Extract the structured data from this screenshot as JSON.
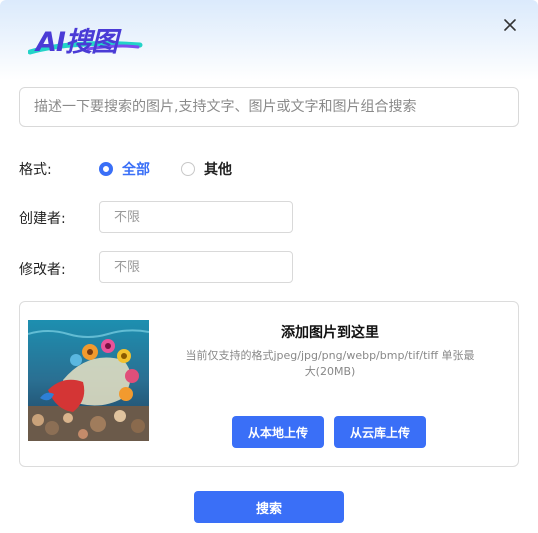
{
  "dialog": {
    "logo_text": "AI搜图",
    "close_icon": "close-icon"
  },
  "search": {
    "placeholder": "描述一下要搜索的图片,支持文字、图片或文字和图片组合搜索",
    "value": ""
  },
  "filters": {
    "format_label": "格式:",
    "format_options": [
      {
        "label": "全部",
        "selected": true
      },
      {
        "label": "其他",
        "selected": false
      }
    ],
    "creator_label": "创建者:",
    "creator_placeholder": "不限",
    "modifier_label": "修改者:",
    "modifier_placeholder": "不限"
  },
  "upload": {
    "title": "添加图片到这里",
    "description": "当前仅支持的格式jpeg/jpg/png/webp/bmp/tif/tiff 单张最大(20MB)",
    "local_button": "从本地上传",
    "cloud_button": "从云库上传",
    "thumbnail_icon": "fish-image"
  },
  "actions": {
    "submit_label": "搜索"
  },
  "colors": {
    "accent": "#3a6ff7",
    "logo": "#4a3bd6",
    "swoosh": "#23d3c8"
  }
}
